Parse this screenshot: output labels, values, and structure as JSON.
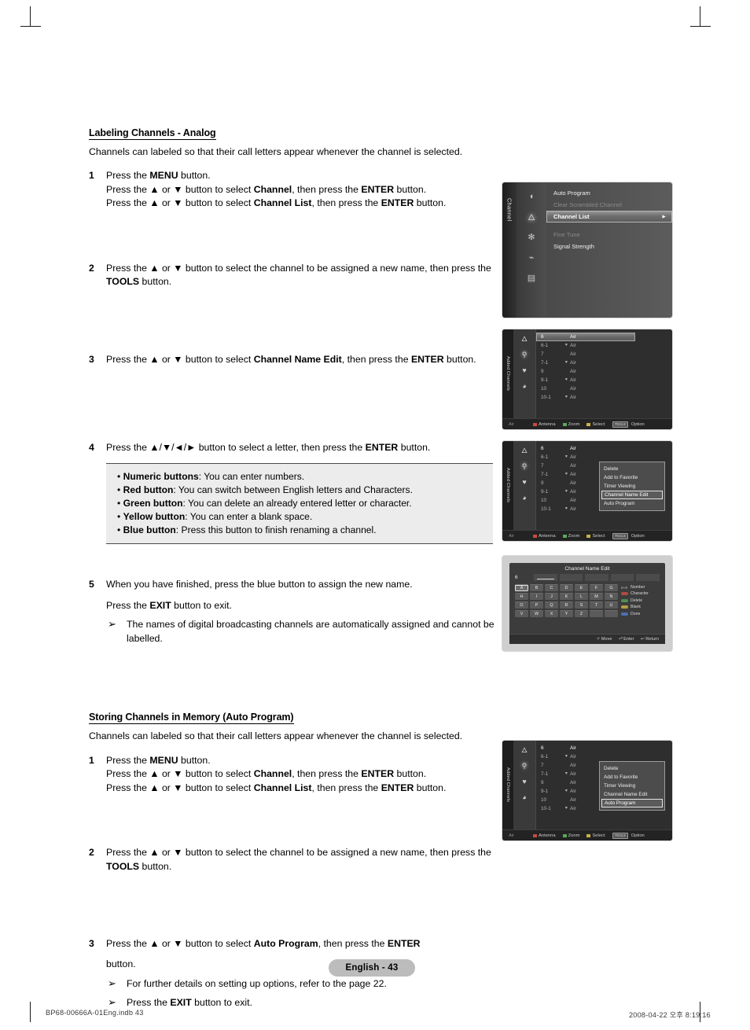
{
  "document": {
    "page_badge": "English - 43",
    "footer_left": "BP68-00666A-01Eng.indb   43",
    "footer_right": "2008-04-22   오후 8:19:16"
  },
  "section1": {
    "title": "Labeling Channels - Analog",
    "intro": "Channels can labeled so that their call letters appear whenever the channel is selected.",
    "steps": [
      {
        "num": "1",
        "lines": [
          "Press the MENU button.",
          "Press the ▲ or ▼ button to select Channel, then press the ENTER button.",
          "Press the ▲ or ▼ button to select Channel List, then press the ENTER button."
        ]
      },
      {
        "num": "2",
        "lines": [
          "Press the ▲ or ▼ button to select the channel to be assigned a new name, then press the TOOLS button."
        ]
      },
      {
        "num": "3",
        "lines": [
          "Press the ▲ or ▼ button to select Channel Name Edit, then press the ENTER button."
        ]
      },
      {
        "num": "4",
        "lines": [
          "Press the ▲/▼/◄/► button to select a letter, then press the ENTER button."
        ]
      },
      {
        "num": "5",
        "lines": [
          "When you have finished, press the blue button to assign the new name."
        ],
        "sub": "Press the EXIT button to exit.",
        "note": "The names of digital broadcasting channels are automatically assigned and cannot be labelled."
      }
    ],
    "infobox": [
      {
        "label": "Numeric buttons",
        "text": ": You can enter numbers."
      },
      {
        "label": "Red button",
        "text": ": You can switch between English letters and Characters."
      },
      {
        "label": "Green button",
        "text": ": You can delete an already entered letter or character."
      },
      {
        "label": "Yellow button",
        "text": ": You can enter a blank space."
      },
      {
        "label": "Blue button",
        "text": ": Press this button to finish renaming a channel."
      }
    ]
  },
  "section2": {
    "title": "Storing Channels in Memory (Auto Program)",
    "intro": "Channels can labeled so that their call letters appear whenever the channel is selected.",
    "steps": [
      {
        "num": "1",
        "lines": [
          "Press the MENU button.",
          "Press the ▲ or ▼ button to select Channel, then press the ENTER button.",
          "Press the ▲ or ▼ button to select Channel List, then press the ENTER button."
        ]
      },
      {
        "num": "2",
        "lines": [
          "Press the ▲ or ▼ button to select the channel to be assigned a new name, then press the TOOLS button."
        ]
      },
      {
        "num": "3",
        "lines": [
          "Press the ▲ or ▼ button to select Auto Program, then press the ENTER",
          "button."
        ],
        "notes": [
          "For further details on setting up options, refer to the page 22.",
          "Press the EXIT button to exit."
        ]
      }
    ]
  },
  "osd_menu": {
    "tab_label": "Channel",
    "items": [
      {
        "label": "Auto Program",
        "state": "normal"
      },
      {
        "label": "Clear Scrambled Channel",
        "state": "dim"
      },
      {
        "label": "Channel List",
        "state": "selected",
        "arrow": "►"
      },
      {
        "label": "Fine Tune",
        "state": "dim"
      },
      {
        "label": "Signal Strength",
        "state": "normal"
      }
    ]
  },
  "osd_channel_list": {
    "tab_label": "Added Channels",
    "rows": [
      {
        "ch": "6",
        "lock": "",
        "name": "Air",
        "highlight": true
      },
      {
        "ch": "6-1",
        "lock": "♥",
        "name": "Air"
      },
      {
        "ch": "7",
        "lock": "",
        "name": "Air"
      },
      {
        "ch": "7-1",
        "lock": "♥",
        "name": "Air"
      },
      {
        "ch": "9",
        "lock": "",
        "name": "Air"
      },
      {
        "ch": "9-1",
        "lock": "♥",
        "name": "Air"
      },
      {
        "ch": "10",
        "lock": "",
        "name": "Air"
      },
      {
        "ch": "10-1",
        "lock": "♥",
        "name": "Air"
      }
    ],
    "bar": {
      "air": "Air",
      "antenna": "Antenna",
      "zoom": "Zoom",
      "select": "Select",
      "tools": "TOOLS",
      "option": "Option"
    }
  },
  "osd_context_menu_a": {
    "items": [
      {
        "label": "Delete"
      },
      {
        "label": "Add to Favorite"
      },
      {
        "label": "Timer Viewing"
      },
      {
        "label": "Channel Name Edit",
        "selected": true
      },
      {
        "label": "Auto Program"
      }
    ]
  },
  "osd_context_menu_b": {
    "items": [
      {
        "label": "Delete"
      },
      {
        "label": "Add to Favorite"
      },
      {
        "label": "Timer Viewing"
      },
      {
        "label": "Channel Name Edit"
      },
      {
        "label": "Auto Program",
        "selected": true
      }
    ]
  },
  "osd_keyboard": {
    "title": "Channel Name Edit",
    "current_channel": "6",
    "keys": [
      "A",
      "B",
      "C",
      "D",
      "E",
      "F",
      "G",
      "H",
      "I",
      "J",
      "K",
      "L",
      "M",
      "N",
      "O",
      "P",
      "Q",
      "R",
      "S",
      "T",
      "U",
      "V",
      "W",
      "X",
      "Y",
      "Z",
      "",
      ""
    ],
    "selected_key": "A",
    "legend": [
      {
        "icon": "0~9",
        "label": "Number",
        "color": "num"
      },
      {
        "icon": "pill",
        "label": "Character",
        "color": "r"
      },
      {
        "icon": "pill",
        "label": "Delete",
        "color": "g"
      },
      {
        "icon": "pill",
        "label": "Blank",
        "color": "y"
      },
      {
        "icon": "pill",
        "label": "Done",
        "color": "b"
      }
    ],
    "footer": [
      {
        "icon": "✧",
        "label": "Move"
      },
      {
        "icon": "⏎",
        "label": "Enter"
      },
      {
        "icon": "↩",
        "label": "Return"
      }
    ]
  }
}
